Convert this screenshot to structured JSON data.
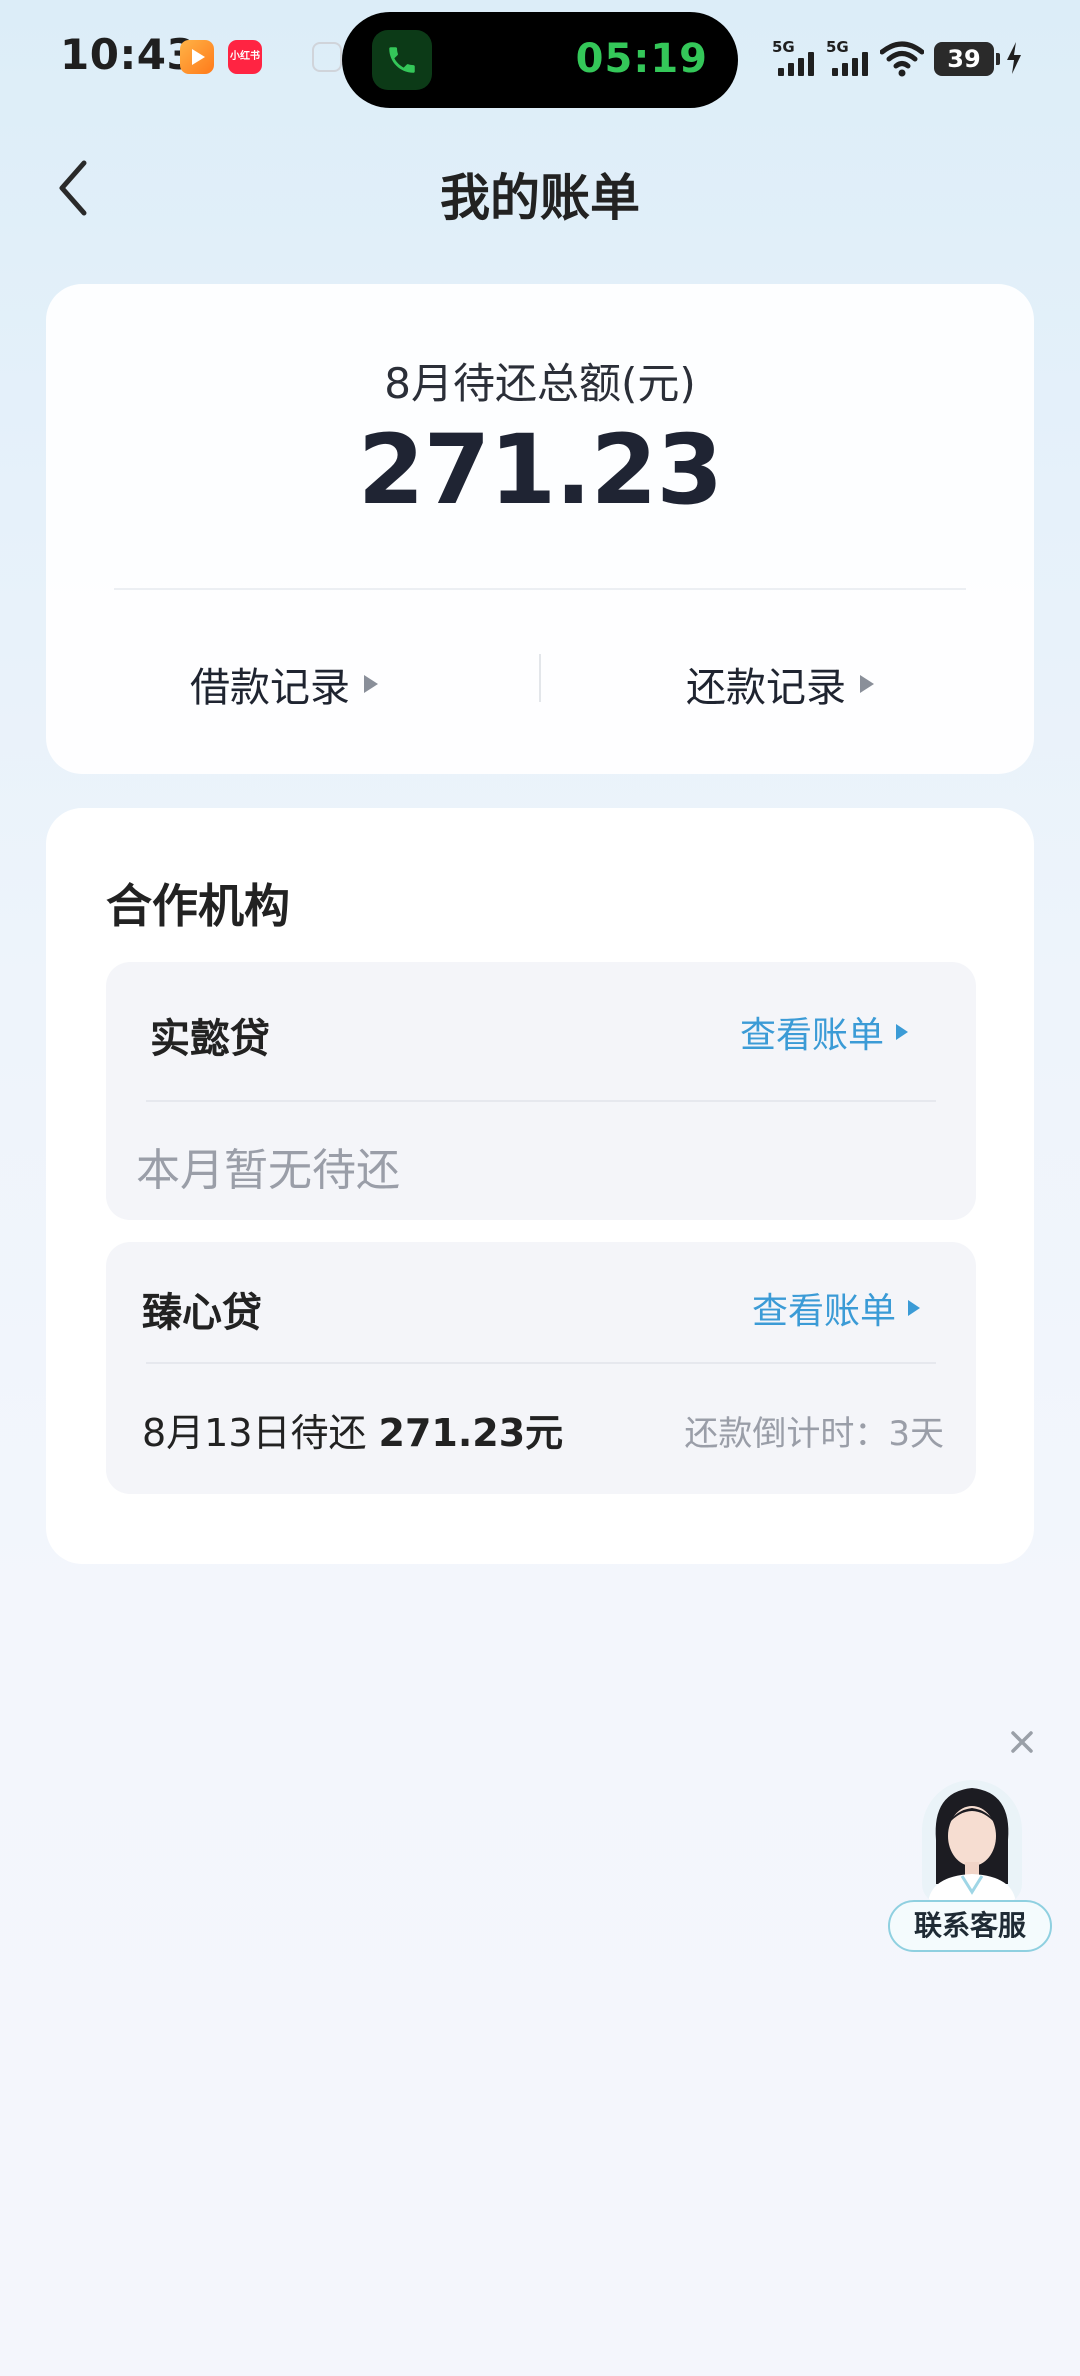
{
  "status_bar": {
    "time": "10:43",
    "call_timer": "05:19",
    "network_1": "5G",
    "network_2": "5G",
    "battery": "39",
    "notification_icons": [
      "video-app-icon",
      "xiaohongshu-icon"
    ],
    "xiaohongshu_label": "小红书"
  },
  "header": {
    "title": "我的账单"
  },
  "summary": {
    "label": "8月待还总额(元)",
    "amount": "271.23",
    "borrow_records": "借款记录",
    "repay_records": "还款记录"
  },
  "partners": {
    "title": "合作机构",
    "lenders": [
      {
        "name": "实懿贷",
        "view_bill": "查看账单",
        "status": "本月暂无待还"
      },
      {
        "name": "臻心贷",
        "view_bill": "查看账单",
        "due_text": "8月13日待还",
        "due_amount": "271.23元",
        "countdown": "还款倒计时：3天"
      }
    ]
  },
  "customer_service": {
    "label": "联系客服"
  },
  "colors": {
    "accent_blue": "#3b9bd6",
    "call_green": "#34c759",
    "text_primary": "#1f2430",
    "text_muted": "#9a9ea8"
  }
}
